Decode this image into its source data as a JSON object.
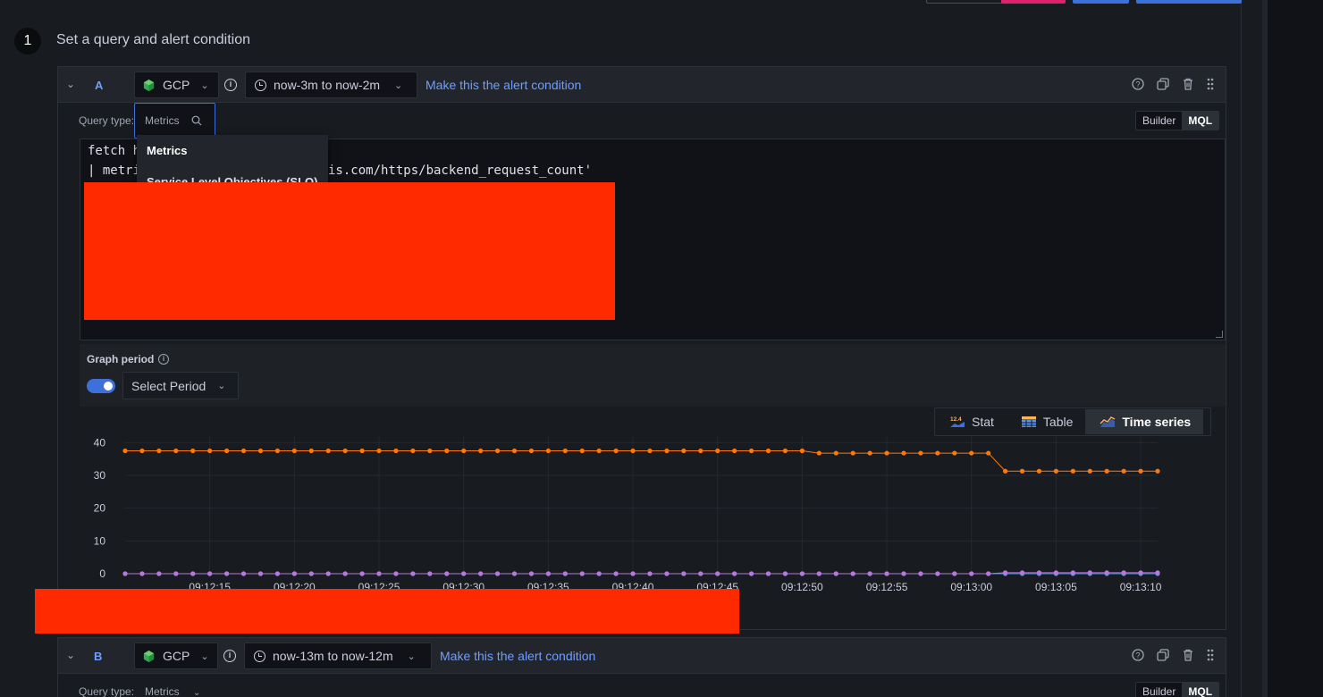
{
  "step": {
    "number": "1",
    "title": "Set a query and alert condition"
  },
  "queries": [
    {
      "letter": "A",
      "datasource": "GCP",
      "time_range": "now-3m to now-2m",
      "alert_link": "Make this the alert condition",
      "query_type_label": "Query type:",
      "query_type_value": "Metrics",
      "modes": [
        "Builder",
        "MQL"
      ],
      "active_mode": "MQL",
      "code_lines": [
        "fetch h",
        "| metri",
        "is.com/https/backend_request_count'"
      ],
      "dropdown_items": [
        "Metrics",
        "Service Level Objectives (SLO)"
      ],
      "graph_period_label": "Graph period",
      "select_period_placeholder": "Select Period",
      "graph_period_enabled": true,
      "viz_options": [
        "Stat",
        "Table",
        "Time series"
      ],
      "active_viz": "Time series",
      "stat_icon_text": "12.4"
    },
    {
      "letter": "B",
      "datasource": "GCP",
      "time_range": "now-13m to now-12m",
      "alert_link": "Make this the alert condition",
      "query_type_label": "Query type:",
      "query_type_value": "Metrics",
      "modes": [
        "Builder",
        "MQL"
      ],
      "active_mode": "MQL"
    }
  ],
  "chart_data": {
    "type": "line",
    "x": [
      "09:12:10",
      "09:12:11",
      "09:12:12",
      "09:12:13",
      "09:12:14",
      "09:12:15",
      "09:12:16",
      "09:12:17",
      "09:12:18",
      "09:12:19",
      "09:12:20",
      "09:12:21",
      "09:12:22",
      "09:12:23",
      "09:12:24",
      "09:12:25",
      "09:12:26",
      "09:12:27",
      "09:12:28",
      "09:12:29",
      "09:12:30",
      "09:12:31",
      "09:12:32",
      "09:12:33",
      "09:12:34",
      "09:12:35",
      "09:12:36",
      "09:12:37",
      "09:12:38",
      "09:12:39",
      "09:12:40",
      "09:12:41",
      "09:12:42",
      "09:12:43",
      "09:12:44",
      "09:12:45",
      "09:12:46",
      "09:12:47",
      "09:12:48",
      "09:12:49",
      "09:12:50",
      "09:12:51",
      "09:12:52",
      "09:12:53",
      "09:12:54",
      "09:12:55",
      "09:12:56",
      "09:12:57",
      "09:12:58",
      "09:12:59",
      "09:13:00",
      "09:13:01",
      "09:13:02",
      "09:13:03",
      "09:13:04",
      "09:13:05",
      "09:13:06",
      "09:13:07",
      "09:13:08",
      "09:13:09",
      "09:13:10",
      "09:13:11"
    ],
    "x_tick_labels": [
      "09:12:15",
      "09:12:20",
      "09:12:25",
      "09:12:30",
      "09:12:35",
      "09:12:40",
      "09:12:45",
      "09:12:50",
      "09:12:55",
      "09:13:00",
      "09:13:05",
      "09:13:10"
    ],
    "y_ticks": [
      0,
      10,
      20,
      30,
      40
    ],
    "ylim": [
      0,
      42
    ],
    "grid": true,
    "series": [
      {
        "color": "#ff780a",
        "values": [
          37.5,
          37.5,
          37.5,
          37.5,
          37.5,
          37.5,
          37.5,
          37.5,
          37.5,
          37.5,
          37.5,
          37.5,
          37.5,
          37.5,
          37.5,
          37.5,
          37.5,
          37.5,
          37.5,
          37.5,
          37.5,
          37.5,
          37.5,
          37.5,
          37.5,
          37.5,
          37.5,
          37.5,
          37.5,
          37.5,
          37.5,
          37.5,
          37.5,
          37.5,
          37.5,
          37.5,
          37.5,
          37.5,
          37.5,
          37.5,
          37.5,
          36.8,
          36.8,
          36.8,
          36.8,
          36.8,
          36.8,
          36.8,
          36.8,
          36.8,
          36.8,
          36.8,
          31.3,
          31.3,
          31.3,
          31.3,
          31.3,
          31.3,
          31.3,
          31.3,
          31.3,
          31.3
        ]
      },
      {
        "color": "#5794f2",
        "values": [
          0,
          0,
          0,
          0,
          0,
          0,
          0,
          0,
          0,
          0,
          0,
          0,
          0,
          0,
          0,
          0,
          0,
          0,
          0,
          0,
          0,
          0,
          0,
          0,
          0,
          0,
          0,
          0,
          0,
          0,
          0,
          0,
          0,
          0,
          0,
          0,
          0,
          0,
          0,
          0,
          0,
          0,
          0,
          0,
          0,
          0,
          0,
          0,
          0,
          0,
          0,
          0,
          0,
          0,
          0,
          0,
          0,
          0,
          0,
          0,
          0,
          0
        ]
      },
      {
        "color": "#b877d9",
        "values": [
          0,
          0,
          0,
          0,
          0,
          0,
          0,
          0,
          0,
          0,
          0,
          0,
          0,
          0,
          0,
          0,
          0,
          0,
          0,
          0,
          0,
          0,
          0,
          0,
          0,
          0,
          0,
          0,
          0,
          0,
          0,
          0,
          0,
          0,
          0,
          0,
          0,
          0,
          0,
          0,
          0,
          0,
          0,
          0,
          0,
          0,
          0,
          0,
          0,
          0,
          0,
          0,
          0.3,
          0.3,
          0.3,
          0.3,
          0.3,
          0.3,
          0.3,
          0.3,
          0.3,
          0.3
        ]
      }
    ]
  },
  "colors": {
    "accent": "#3d71d9",
    "link": "#6e9fff",
    "redaction": "#ff2a00",
    "top_btn_pink": "#e0226e",
    "top_btn_blue": "#3d71d9"
  }
}
